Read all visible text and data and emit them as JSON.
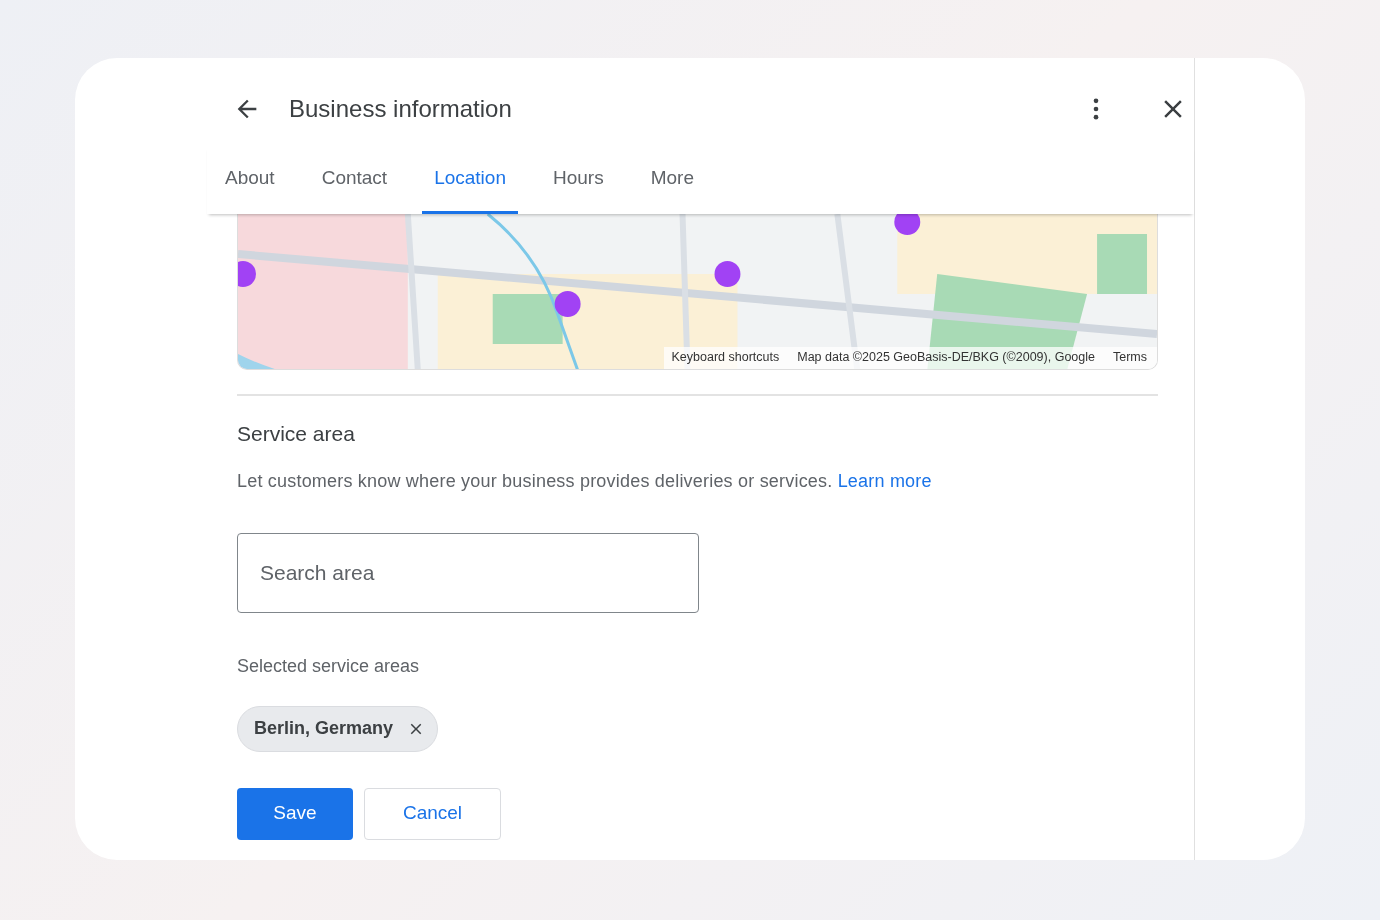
{
  "dialog": {
    "title": "Business information"
  },
  "tabs": [
    {
      "label": "About",
      "selected": false
    },
    {
      "label": "Contact",
      "selected": false
    },
    {
      "label": "Location",
      "selected": true
    },
    {
      "label": "Hours",
      "selected": false
    },
    {
      "label": "More",
      "selected": false
    }
  ],
  "map": {
    "attribution": [
      "Keyboard shortcuts",
      "Map data ©2025 GeoBasis-DE/BKG (©2009), Google",
      "Terms"
    ]
  },
  "service_area": {
    "heading": "Service area",
    "description": "Let customers know where your business provides deliveries or services.",
    "link": "Learn more",
    "search": {
      "placeholder": "Search area"
    },
    "selected_label": "Selected service areas",
    "chips": [
      {
        "label": "Berlin, Germany"
      }
    ]
  },
  "buttons": [
    {
      "label": "Save",
      "kind": "primary"
    },
    {
      "label": "Cancel",
      "kind": "secondary"
    }
  ]
}
